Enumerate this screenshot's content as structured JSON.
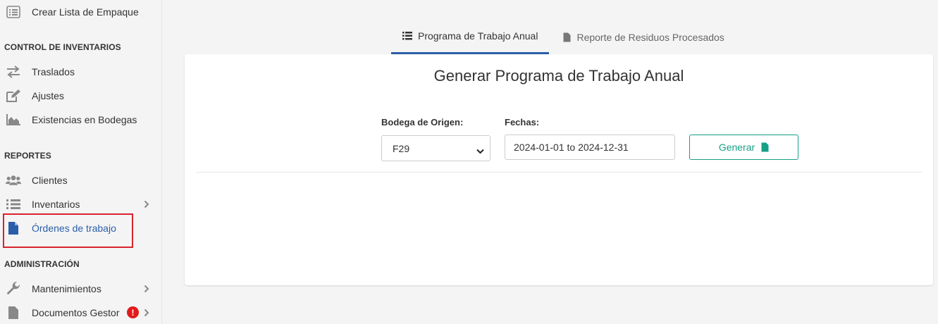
{
  "sidebar": {
    "top_item": "Crear Lista de Empaque",
    "sections": {
      "inventarios": "CONTROL DE INVENTARIOS",
      "reportes": "REPORTES",
      "administracion": "ADMINISTRACIÓN"
    },
    "items": {
      "traslados": "Traslados",
      "ajustes": "Ajustes",
      "existencias": "Existencias en Bodegas",
      "clientes": "Clientes",
      "inventarios": "Inventarios",
      "ordenes": "Órdenes de trabajo",
      "mantenimientos": "Mantenimientos",
      "documentos": "Documentos Gestor"
    },
    "badge": "!"
  },
  "tabs": [
    {
      "label": "Programa de Trabajo Anual",
      "active": true
    },
    {
      "label": "Reporte de Residuos Procesados",
      "active": false
    }
  ],
  "form": {
    "title": "Generar Programa de Trabajo Anual",
    "bodega_label": "Bodega de Origen:",
    "bodega_value": "F29",
    "fechas_label": "Fechas:",
    "fechas_value": "2024-01-01 to 2024-12-31",
    "generar_label": "Generar"
  },
  "colors": {
    "accent": "#2a5ea8",
    "button": "#16a085",
    "highlight": "#d9232d",
    "badge": "#e31a1a"
  }
}
